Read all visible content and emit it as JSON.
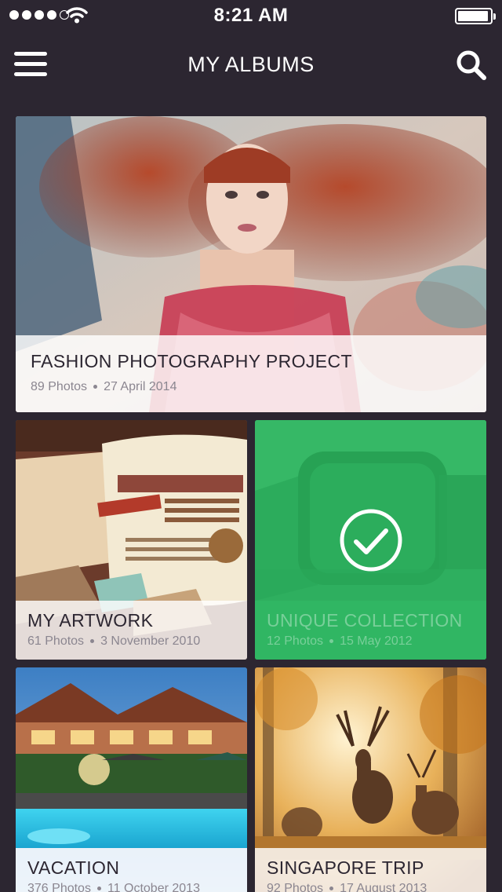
{
  "status_bar": {
    "time": "8:21 AM",
    "signal_bars": 4,
    "signal_max": 5,
    "battery_level": 0.95
  },
  "nav": {
    "title": "MY ALBUMS",
    "menu_icon": "hamburger-menu-icon",
    "search_icon": "search-icon"
  },
  "albums": [
    {
      "title": "FASHION PHOTOGRAPHY PROJECT",
      "count": "89 Photos",
      "date": "27 April 2014",
      "selected": false
    },
    {
      "title": "MY ARTWORK",
      "count": "61 Photos",
      "date": "3 November 2010",
      "selected": false
    },
    {
      "title": "UNIQUE COLLECTION",
      "count": "12 Photos",
      "date": "15 May 2012",
      "selected": true
    },
    {
      "title": "VACATION",
      "count": "376 Photos",
      "date": "11 October 2013",
      "selected": false
    },
    {
      "title": "SINGAPORE TRIP",
      "count": "92 Photos",
      "date": "17 August 2013",
      "selected": false
    }
  ],
  "colors": {
    "background": "#2c2631",
    "selected_overlay": "#2fb563",
    "caption_text": "#2c2631"
  }
}
